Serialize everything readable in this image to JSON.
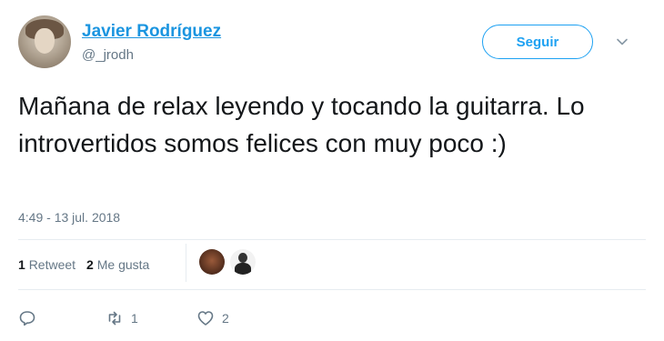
{
  "author": {
    "display_name": "Javier Rodríguez",
    "handle": "@_jrodh"
  },
  "follow_button": {
    "label": "Seguir"
  },
  "tweet": {
    "text": "Mañana de relax leyendo y tocando la guitarra. Lo introvertidos somos felices con muy poco :)",
    "timestamp": "4:49 - 13 jul. 2018"
  },
  "stats": {
    "retweets_count": "1",
    "retweets_label": "Retweet",
    "likes_count": "2",
    "likes_label": "Me gusta"
  },
  "actions": {
    "reply_icon": "reply-icon",
    "retweet_icon": "retweet-icon",
    "retweet_count": "1",
    "like_icon": "heart-icon",
    "like_count": "2"
  },
  "colors": {
    "accent": "#1da1f2",
    "name_link": "#1b95e0",
    "secondary_text": "#657786"
  }
}
